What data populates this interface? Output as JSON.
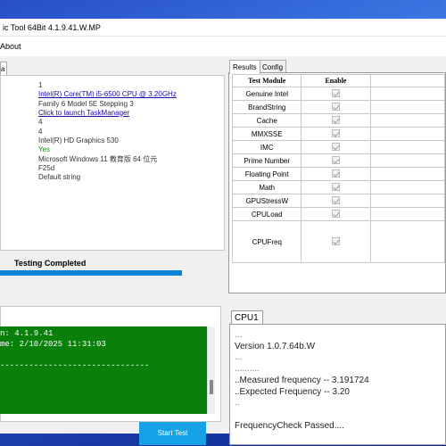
{
  "window": {
    "title": "ic Tool 64Bit 4.1.9.41.W.MP",
    "menu_about": "About"
  },
  "left_tab": {
    "label": "a"
  },
  "info_lines": [
    {
      "text": "1",
      "style": "normal"
    },
    {
      "text": "Intel(R) Core(TM) i5-6500 CPU @ 3.20GHz",
      "style": "link"
    },
    {
      "text": "Family 6 Model 5E Stepping 3",
      "style": "normal"
    },
    {
      "text": "Click to launch TaskManager",
      "style": "link"
    },
    {
      "text": "4",
      "style": "normal"
    },
    {
      "text": "4",
      "style": "normal"
    },
    {
      "text": "Intel(R) HD Graphics 530",
      "style": "normal"
    },
    {
      "text": "Yes",
      "style": "green"
    },
    {
      "text": "Microsoft Windows 11 教育版 64 位元",
      "style": "normal"
    },
    {
      "text": "F25d",
      "style": "normal"
    },
    {
      "text": "Default string",
      "style": "normal"
    }
  ],
  "status": {
    "text": "Testing Completed",
    "progress": 1.0
  },
  "tabs": {
    "results": "Results",
    "config": "Config"
  },
  "results_table": {
    "headers": [
      "Test Module",
      "Enable"
    ],
    "rows": [
      {
        "module": "Genuine Intel",
        "enabled": true
      },
      {
        "module": "BrandString",
        "enabled": true
      },
      {
        "module": "Cache",
        "enabled": true
      },
      {
        "module": "MMXSSE",
        "enabled": true
      },
      {
        "module": "IMC",
        "enabled": true
      },
      {
        "module": "Prime Number",
        "enabled": true
      },
      {
        "module": "Floating Point",
        "enabled": true
      },
      {
        "module": "Math",
        "enabled": true
      },
      {
        "module": "GPUStressW",
        "enabled": true
      },
      {
        "module": "CPULoad",
        "enabled": true
      },
      {
        "module": "CPUFreq",
        "enabled": true
      }
    ]
  },
  "console": {
    "lines": [
      "n: 4.1.9.41",
      "me: 2/10/2025 11:31:03",
      "",
      "-------------------------------"
    ],
    "background": "#08800a"
  },
  "start_button": {
    "label": "Start Test",
    "color": "#17a2e6"
  },
  "cpu_panel": {
    "tab_label": "CPU1",
    "lines": [
      {
        "text": "...",
        "dim": true
      },
      {
        "text": "Version 1.0.7.64b.W",
        "dim": false
      },
      {
        "text": "...",
        "dim": true
      },
      {
        "text": "..........",
        "dim": true
      },
      {
        "text": "..Measured frequency -- 3.191724",
        "dim": false
      },
      {
        "text": "..Expected Frequency -- 3.20",
        "dim": false
      },
      {
        "text": "..",
        "dim": true
      },
      {
        "text": "",
        "dim": false
      },
      {
        "text": "FrequencyCheck Passed....",
        "dim": false
      }
    ]
  }
}
